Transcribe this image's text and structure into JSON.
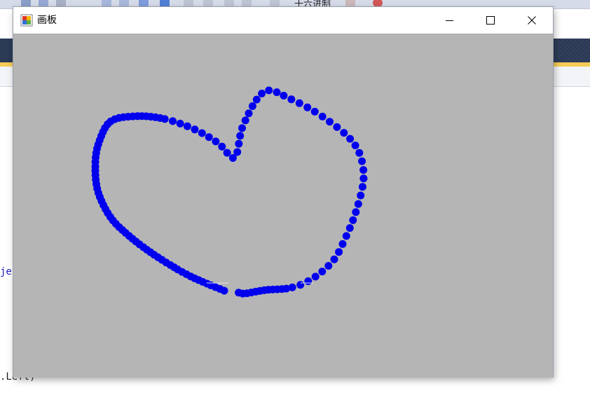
{
  "ide": {
    "toolbar_text": "十六进制",
    "code_fragment_1": "je",
    "code_fragment_2": ".Left)"
  },
  "window": {
    "title": "画板",
    "icon": "winforms-app-icon",
    "buttons": {
      "minimize": "minimize-icon",
      "maximize": "maximize-icon",
      "close": "close-icon"
    }
  },
  "canvas": {
    "background": "#b5b5b5",
    "stroke_color": "#0000ee",
    "drawing": "heart-shaped stroke of blue dots"
  }
}
